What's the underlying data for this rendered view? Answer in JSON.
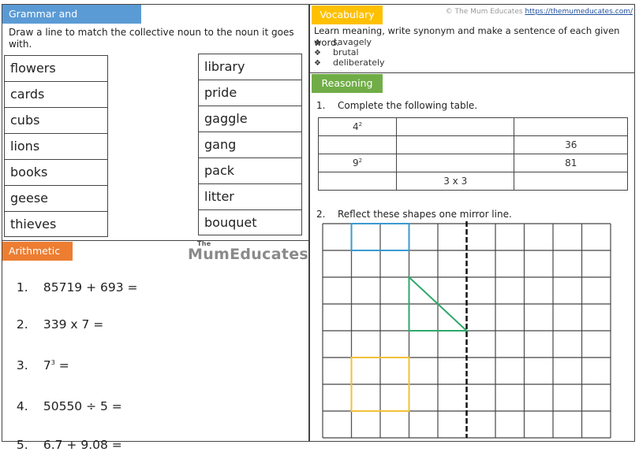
{
  "credit": {
    "prefix": "© The Mum Educates",
    "link": "https://themumeducates.com/"
  },
  "grammar": {
    "label": "Grammar and punctuation",
    "instruction": "Draw a line to match the collective noun to the noun it goes with.",
    "left_nouns": [
      "flowers",
      "cards",
      "cubs",
      "lions",
      "books",
      "geese",
      "thieves"
    ],
    "right_nouns": [
      "library",
      "pride",
      "gaggle",
      "gang",
      "pack",
      "litter",
      "bouquet"
    ]
  },
  "arithmetic": {
    "label": "Arithmetic",
    "logo_small": "The",
    "logo_text": "MumEducates",
    "items": [
      {
        "num": "1.",
        "expr": "85719 + 693 ="
      },
      {
        "num": "2.",
        "expr": "339 x 7 ="
      },
      {
        "num": "3.",
        "base": "7",
        "exp": "3",
        "tail": " ="
      },
      {
        "num": "4.",
        "expr": "50550 ÷ 5 ="
      },
      {
        "num": "5.",
        "expr": "6.7 + 9.08 ="
      }
    ]
  },
  "vocabulary": {
    "label": "Vocabulary",
    "instruction": "Learn meaning, write synonym and make a sentence of each given word.",
    "bullet_icon": "❖",
    "words": [
      "savagely",
      "brutal",
      "deliberately"
    ]
  },
  "reasoning": {
    "label": "Reasoning",
    "q1": {
      "num": "1.",
      "text": "Complete the following table."
    },
    "table": [
      [
        {
          "base": "4",
          "exp": "2"
        },
        {
          "text": ""
        },
        {
          "text": ""
        }
      ],
      [
        {
          "text": ""
        },
        {
          "text": ""
        },
        {
          "text": "36"
        }
      ],
      [
        {
          "base": "9",
          "exp": "2"
        },
        {
          "text": ""
        },
        {
          "text": "81"
        }
      ],
      [
        {
          "text": ""
        },
        {
          "text": "3 x 3"
        },
        {
          "text": ""
        }
      ]
    ],
    "q2": {
      "num": "2.",
      "text": "Reflect these shapes one mirror line."
    },
    "grid": {
      "cols": 10,
      "rows": 8,
      "mirror_col": 5,
      "shapes": [
        {
          "name": "blue-rectangle",
          "color": "#3a9ad0",
          "points": [
            [
              1,
              0
            ],
            [
              3,
              0
            ],
            [
              3,
              1
            ],
            [
              1,
              1
            ]
          ]
        },
        {
          "name": "green-triangle",
          "color": "#2ea86a",
          "points": [
            [
              3,
              2
            ],
            [
              3,
              4
            ],
            [
              5,
              4
            ]
          ]
        },
        {
          "name": "yellow-rectangle",
          "color": "#f2c037",
          "points": [
            [
              1,
              5
            ],
            [
              3,
              5
            ],
            [
              3,
              7
            ],
            [
              1,
              7
            ]
          ]
        }
      ]
    }
  }
}
